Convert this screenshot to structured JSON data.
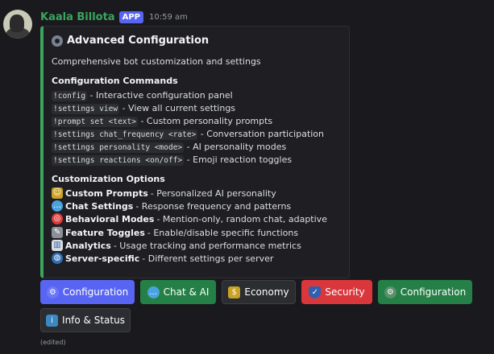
{
  "message": {
    "author": "Kaala Billota",
    "badge": "APP",
    "time": "10:59 am",
    "edited": "(edited)"
  },
  "embed": {
    "title": "Advanced Configuration",
    "description": "Comprehensive bot customization and settings",
    "commands_heading": "Configuration Commands",
    "commands": [
      {
        "code": "!config",
        "text": " - Interactive configuration panel"
      },
      {
        "code": "!settings view",
        "text": " - View all current settings"
      },
      {
        "code": "!prompt set <text>",
        "text": " - Custom personality prompts"
      },
      {
        "code": "!settings chat_frequency <rate>",
        "text": " - Conversation participation"
      },
      {
        "code": "!settings personality <mode>",
        "text": " - AI personality modes"
      },
      {
        "code": "!settings reactions <on/off>",
        "text": " - Emoji reaction toggles"
      }
    ],
    "options_heading": "Customization Options",
    "options": [
      {
        "icon": "theater-masks-icon",
        "bold": "Custom Prompts",
        "text": " - Personalized AI personality"
      },
      {
        "icon": "speech-bubble-icon",
        "bold": "Chat Settings",
        "text": " - Response frequency and patterns"
      },
      {
        "icon": "target-icon",
        "bold": "Behavioral Modes",
        "text": " - Mention-only, random chat, adaptive"
      },
      {
        "icon": "wrench-icon",
        "bold": "Feature Toggles",
        "text": " - Enable/disable specific functions"
      },
      {
        "icon": "chart-icon",
        "bold": "Analytics",
        "text": " - Usage tracking and performance metrics"
      },
      {
        "icon": "globe-icon",
        "bold": "Server-specific",
        "text": " - Different settings per server"
      }
    ]
  },
  "buttons": {
    "configuration_primary": "Configuration",
    "chat_ai": "Chat & AI",
    "economy": "Economy",
    "security": "Security",
    "configuration_success": "Configuration",
    "info_status": "Info & Status"
  },
  "colors": {
    "primary": "#5865f2",
    "success": "#248046",
    "danger": "#da373c",
    "secondary": "#2b2d31",
    "accent_border": "#3ba55c"
  }
}
